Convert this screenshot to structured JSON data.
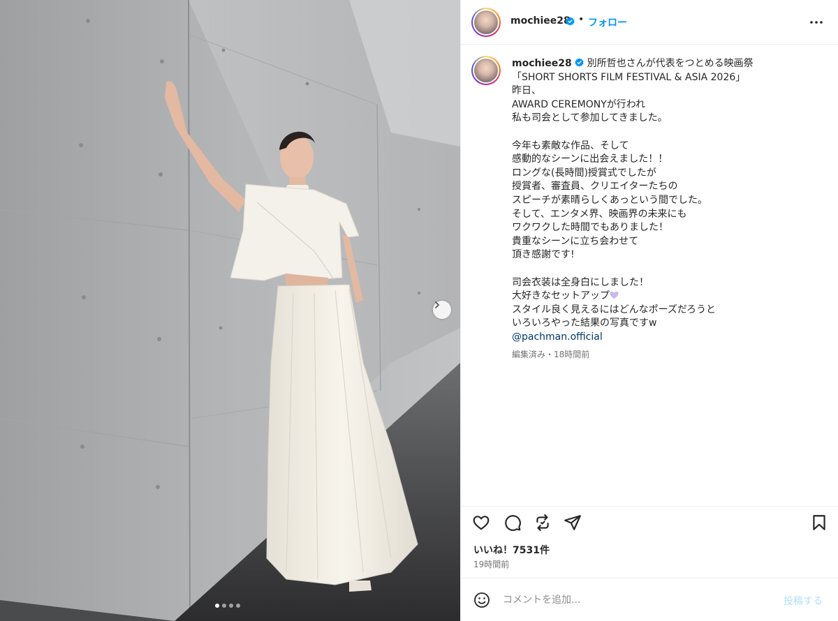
{
  "header": {
    "username": "mochiee28",
    "separator": "•",
    "follow_label": "フォロー"
  },
  "caption": {
    "username": "mochiee28",
    "text_main": "別所哲也さんが代表をつとめる映画祭\n「SHORT SHORTS FILM FESTIVAL & ASIA 2026」\n昨日、\nAWARD CEREMONYが行われ\n私も司会として参加してきました。\n\n今年も素敵な作品、そして\n感動的なシーンに出会えました！！\nロングな(長時間)授賞式でしたが\n授賞者、審査員、クリエイターたちの\nスピーチが素晴らしくあっという間でした。\nそして、エンタメ界、映画界の未来にも\nワクワクした時間でもありました！\n貴重なシーンに立ち会わせて\n頂き感謝です!\n\n司会衣装は全身白にしました！\n大好きなセットアップ",
    "text_tail": "\nスタイル良く見えるにはどんなポーズだろうと\nいろいろやった結果の写真ですw",
    "mention": "@pachman.official",
    "meta": "編集済み・18時間前"
  },
  "engagement": {
    "likes": "いいね！7531件",
    "posted": "19時間前"
  },
  "comment": {
    "placeholder": "コメントを追加...",
    "post_label": "投稿する"
  },
  "carousel": {
    "current": 1,
    "total": 4
  },
  "colors": {
    "accent": "#0095f6",
    "mention": "#00376b",
    "muted": "#737373",
    "post_disabled": "#b2dffc"
  }
}
